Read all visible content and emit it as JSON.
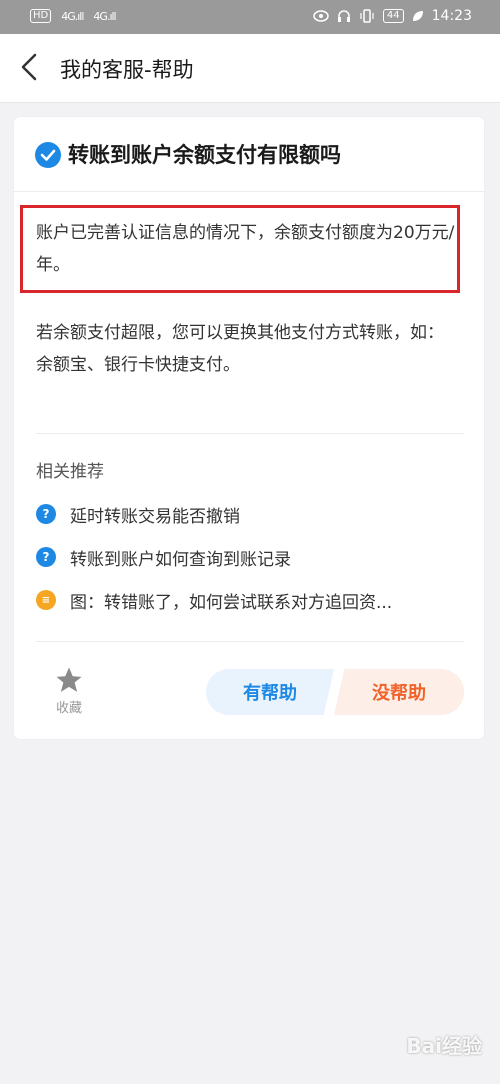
{
  "status_bar": {
    "hd_label": "HD",
    "signal1": "4G.ıll",
    "signal2": "4G.ıll",
    "battery": "44",
    "time": "14:23"
  },
  "header": {
    "title": "我的客服-帮助"
  },
  "question": {
    "title": "转账到账户余额支付有限额吗"
  },
  "answer": {
    "paragraph1": "账户已完善认证信息的情况下，余额支付额度为20万元/年。",
    "paragraph2": "若余额支付超限，您可以更换其他支付方式转账，如：余额宝、银行卡快捷支付。"
  },
  "related": {
    "title": "相关推荐",
    "items": [
      {
        "icon": "question-icon",
        "text": "延时转账交易能否撤销"
      },
      {
        "icon": "question-icon",
        "text": "转账到账户如何查询到账记录"
      },
      {
        "icon": "document-icon",
        "text": "图：转错账了，如何尝试联系对方追回资..."
      }
    ]
  },
  "feedback": {
    "favorite_label": "收藏",
    "helpful_label": "有帮助",
    "not_helpful_label": "没帮助"
  },
  "watermark": {
    "text": "Bai经验"
  },
  "colors": {
    "accent_blue": "#1e88e5",
    "highlight_red": "#d8262c",
    "not_helpful_orange": "#f0632a"
  }
}
